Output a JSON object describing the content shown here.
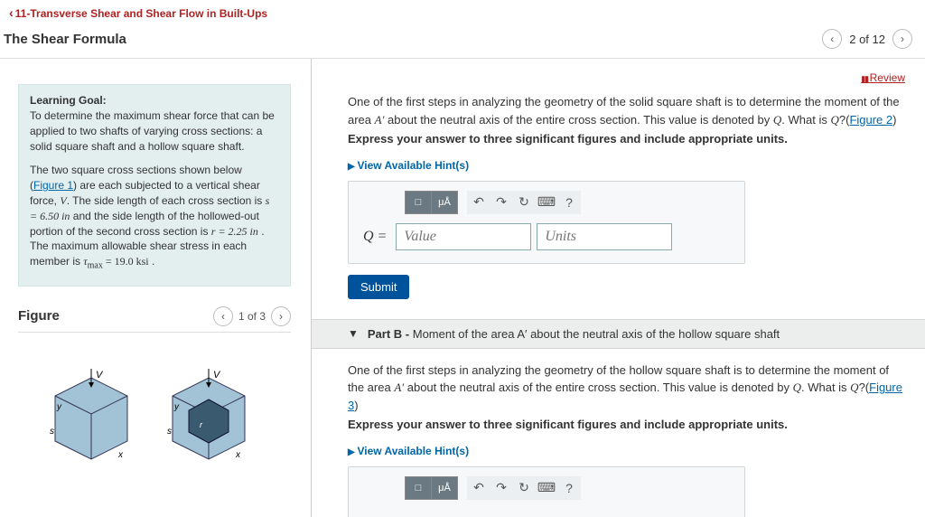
{
  "nav": {
    "back": "11-Transverse Shear and Shear Flow in Built-Ups",
    "title": "The Shear Formula",
    "pager": "2 of 12"
  },
  "review": "Review",
  "learning_goal": {
    "heading": "Learning Goal:",
    "p1": "To determine the maximum shear force that can be applied to two shafts of varying cross sections: a solid square shaft and a hollow square shaft.",
    "p2a": "The two square cross sections shown below (",
    "fig1": "Figure 1",
    "p2b": ") are each subjected to a vertical shear force, ",
    "varV": "V",
    "p2c": ". The side length of each cross section is ",
    "eq_s": "s = 6.50 in",
    "p2d": " and the side length of the hollowed-out portion of the second cross section is ",
    "eq_r": "r = 2.25 in",
    "p2e": " . The maximum allowable shear stress in each member is ",
    "eq_tau": "τ",
    "eq_tau_sub": "max",
    "eq_tau_val": " = 19.0 ksi",
    "p2f": " ."
  },
  "figure": {
    "label": "Figure",
    "pager": "1 of 3"
  },
  "partA": {
    "prompt_a": "One of the first steps in analyzing the geometry of the solid square shaft is to determine the moment of the area ",
    "A_prime": "A′",
    "prompt_b": " about the neutral axis of the entire cross section. This value is denoted by ",
    "Q": "Q",
    "prompt_c": ". What is ",
    "prompt_d": "?(",
    "fig2": "Figure 2",
    "prompt_e": ")",
    "express": "Express your answer to three significant figures and include appropriate units.",
    "hints": "View Available Hint(s)",
    "q_label": "Q =",
    "value_ph": "Value",
    "units_ph": "Units",
    "submit": "Submit"
  },
  "partB": {
    "header_pre": "Part B - ",
    "header": "Moment of the area A′ about the neutral axis of the hollow square shaft",
    "prompt_a": "One of the first steps in analyzing the geometry of the hollow square shaft is to determine the moment of the area ",
    "A_prime": "A′",
    "prompt_b": " about the neutral axis of the entire cross section. This value is denoted by ",
    "Q": "Q",
    "prompt_c": ". What is ",
    "prompt_d": "?(",
    "fig3": "Figure 3",
    "prompt_e": ")",
    "express": "Express your answer to three significant figures and include appropriate units.",
    "hints": "View Available Hint(s)"
  },
  "tools": {
    "t1": "□",
    "t2": "μÅ",
    "undo": "↶",
    "redo": "↷",
    "reset": "↻",
    "kbd": "⌨",
    "help": "?"
  }
}
